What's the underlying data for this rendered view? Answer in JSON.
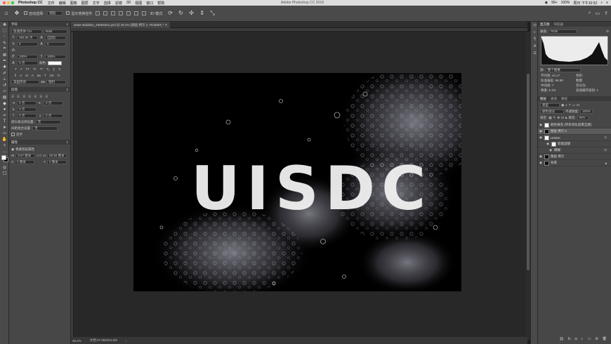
{
  "macbar": {
    "app_name": "Photoshop CC",
    "menus": [
      "文件",
      "编辑",
      "图像",
      "图层",
      "文字",
      "选择",
      "滤镜",
      "3D",
      "视图",
      "窗口",
      "帮助"
    ],
    "center_title": "Adobe Photoshop CC 2018",
    "status": [
      "99+",
      "100%",
      "周日 下午10:52"
    ]
  },
  "options": {
    "auto_select_label": "自动选择:",
    "auto_select_value": "图层",
    "transform_label": "显示变换控件",
    "mode_label": "3D 模式:"
  },
  "document": {
    "tab_title": "water-Bubbles_19606251.psd @ 25.2% (图层 拷贝 2, RGB/8#) *",
    "zoom": "25.2%",
    "doc_info": "文档:47.8M/204.5M",
    "headline": "UISDC"
  },
  "left_panel": {
    "char_tab": "字符",
    "font_family": "思源黑体 CN",
    "font_style": "Bold",
    "font_size": "383.86 点",
    "leading": "(自动)",
    "tracking": "0",
    "kerning": "0",
    "vert_scale": "100%",
    "horiz_scale": "100%",
    "baseline": "0 点",
    "color_label": "颜色:",
    "lang": "美国英语",
    "aa": "锐利",
    "para_tab": "段落",
    "indent_left": "0 点",
    "indent_right": "0 点",
    "first_indent": "0 点",
    "space_before": "0 点",
    "space_after": "0 点",
    "kinsoku_label": "避头尾法则设置:",
    "kinsoku_value": "无",
    "mojikumi_label": "间距组合设置:",
    "mojikumi_value": "无",
    "hyphen": "连字",
    "props_tab": "属性",
    "props_layer": "像素图层属性",
    "w_label": "W",
    "w_value": "9.67 厘米",
    "h_label": "H",
    "h_value": "58.58 厘米",
    "x_label": "X",
    "x_value": "0 厘米",
    "y_label": "Y",
    "y_value": "0 厘米"
  },
  "right_panel": {
    "histogram_tabs": [
      "直方图",
      "导航器"
    ],
    "channel_label": "通道:",
    "channel_value": "RGB",
    "source_label": "源:",
    "source_value": "整个图像",
    "stats_left": [
      [
        "平均值:",
        "44.17"
      ],
      [
        "标准偏差:",
        "58.89"
      ],
      [
        "中间值:",
        "7"
      ],
      [
        "像素:",
        "9 2/4"
      ]
    ],
    "stats_right": [
      [
        "色阶:",
        ""
      ],
      [
        "数量:",
        ""
      ],
      [
        "百分位:",
        ""
      ],
      [
        "高速缓存级别:",
        "1"
      ]
    ],
    "layer_tabs": [
      "图层",
      "通道",
      "路径"
    ],
    "kind_label": "类型",
    "blend_mode": "颜色减淡",
    "opacity_label": "不透明度:",
    "opacity_value": "100%",
    "lock_label": "锁定:",
    "fill_label": "填充:",
    "fill_value": "50%",
    "layers": [
      {
        "name": "颜色填充 (带有羽化遮罩全部)",
        "selected": false,
        "white": true
      },
      {
        "name": "图层 拷贝 2",
        "selected": true,
        "white": false
      },
      {
        "name": "UISDC",
        "selected": false,
        "white": true
      },
      {
        "name": "智能滤镜",
        "selected": false,
        "white": true
      },
      {
        "name": "模糊",
        "selected": false,
        "white": false
      },
      {
        "name": "图层 拷贝",
        "selected": false,
        "white": false
      },
      {
        "name": "背景",
        "selected": false,
        "white": false
      }
    ]
  }
}
